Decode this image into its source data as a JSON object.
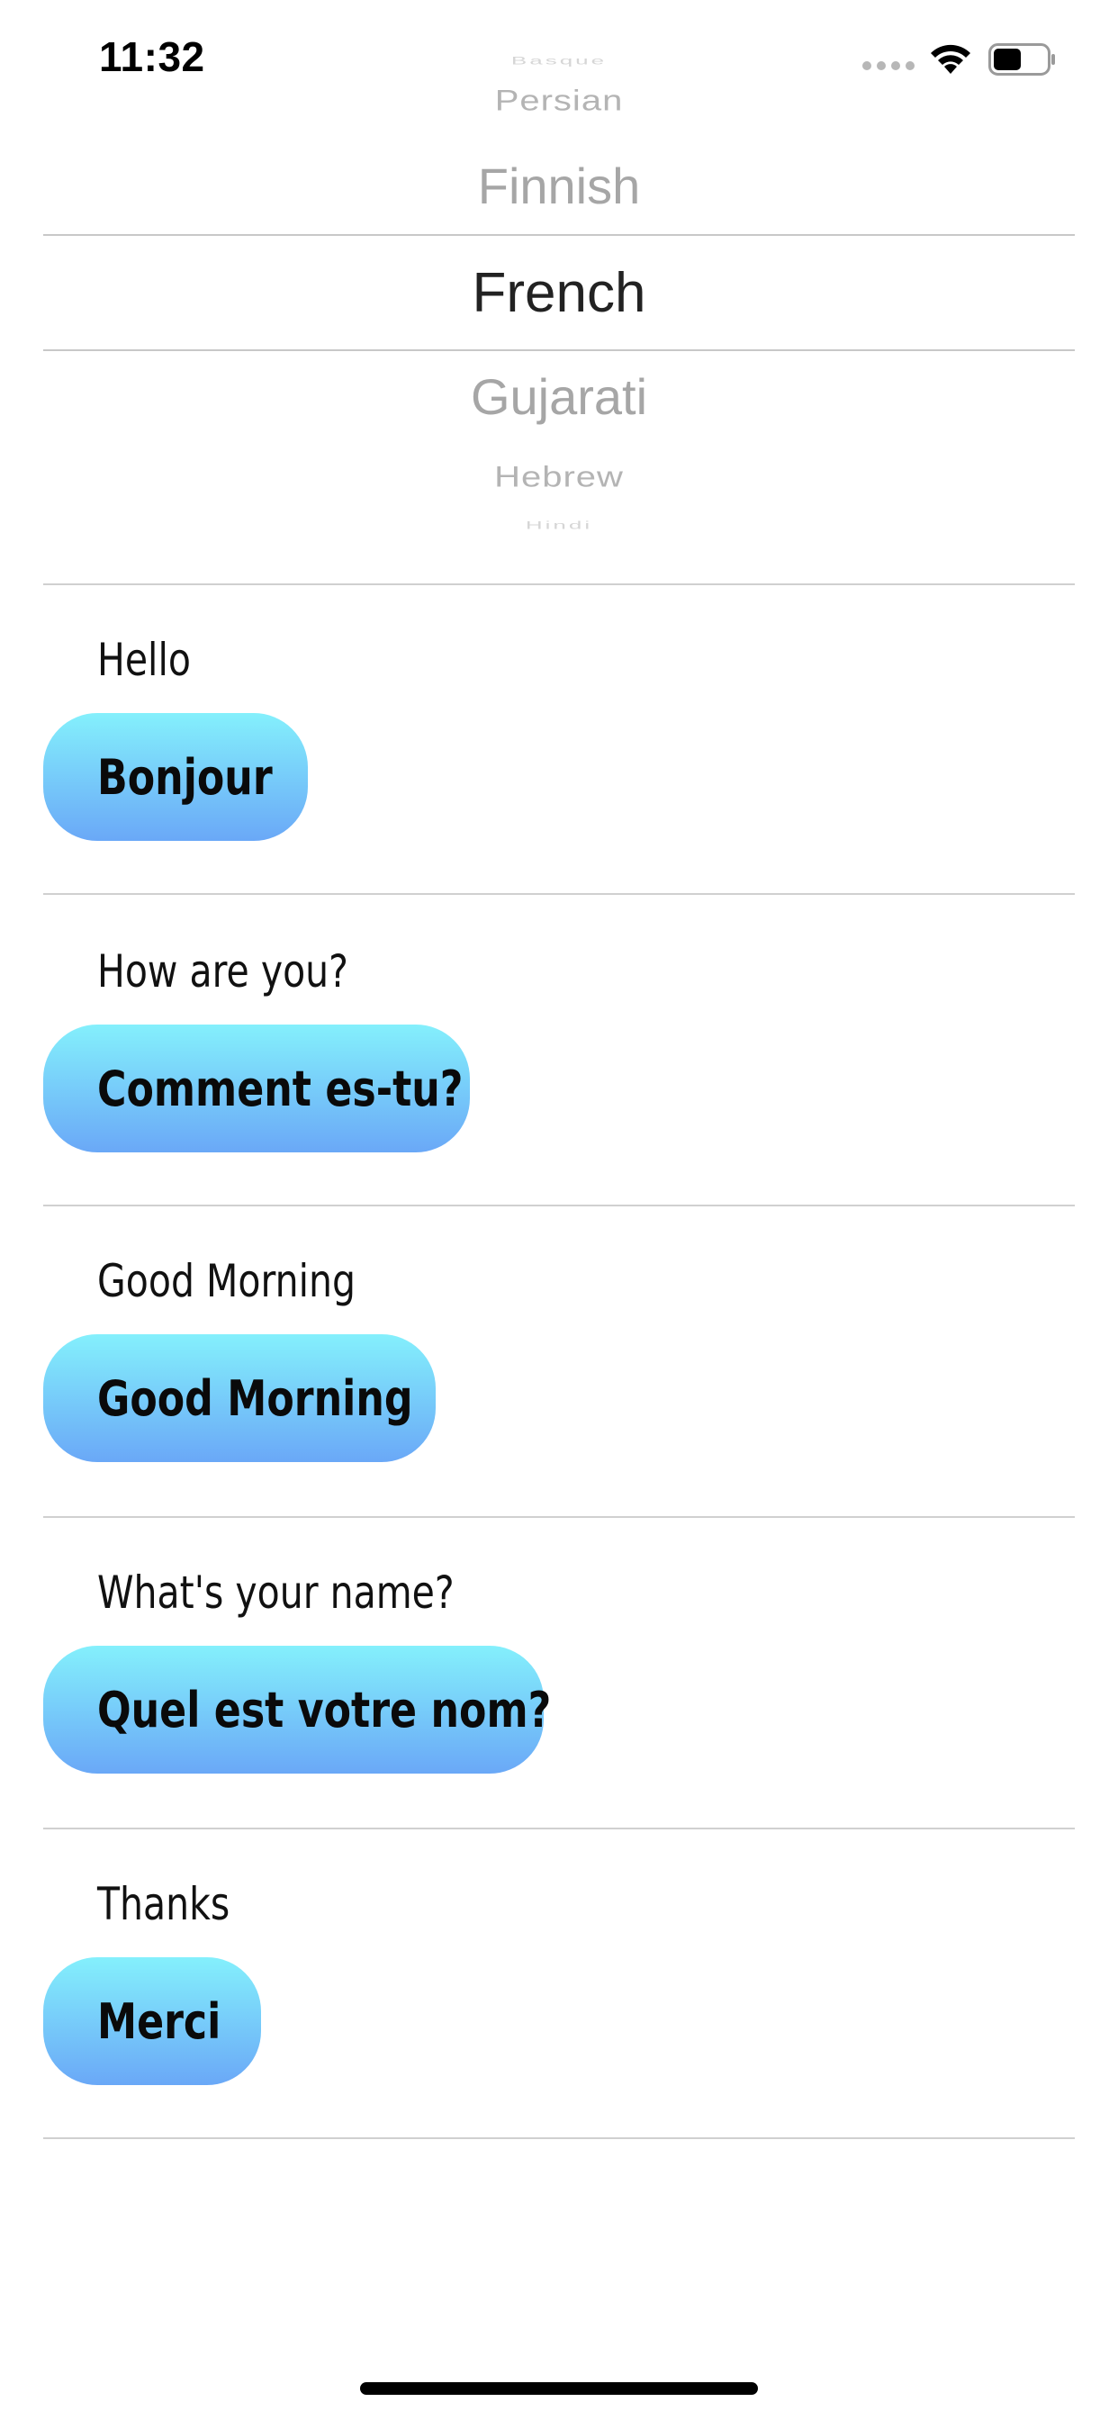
{
  "status_bar": {
    "time": "11:32"
  },
  "language_picker": {
    "items": [
      "Basque",
      "Persian",
      "Finnish",
      "French",
      "Gujarati",
      "Hebrew",
      "Hindi"
    ],
    "selected": "French"
  },
  "phrases": [
    {
      "english": "Hello",
      "translation": "Bonjour"
    },
    {
      "english": "How are you?",
      "translation": "Comment es-tu?"
    },
    {
      "english": "Good Morning",
      "translation": "Good Morning"
    },
    {
      "english": "What's your name?",
      "translation": "Quel est votre nom?"
    },
    {
      "english": "Thanks",
      "translation": "Merci"
    }
  ],
  "colors": {
    "bubble_gradient_top": "#84f0fc",
    "bubble_gradient_bottom": "#6aa8f7",
    "picker_selected_text": "#222222",
    "picker_unselected_text": "#a6a6a6"
  }
}
